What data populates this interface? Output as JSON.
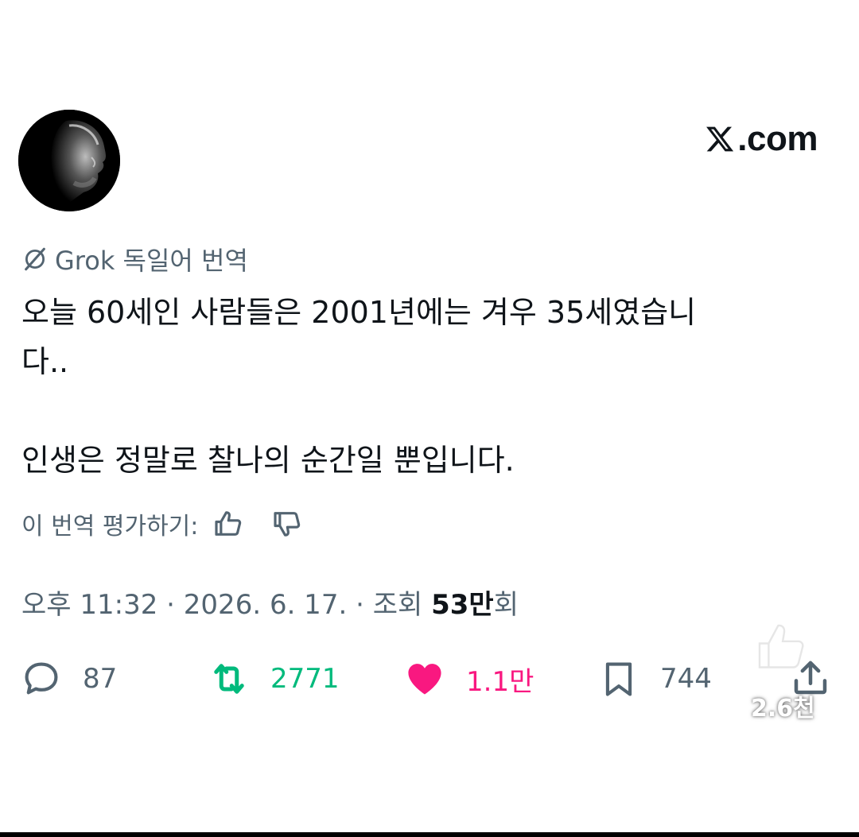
{
  "brand": {
    "icon": "x-logo-icon",
    "text": ".com"
  },
  "translation": {
    "icon": "grok-icon",
    "label": "Grok 독일어 번역"
  },
  "tweet": {
    "line1": "오늘 60세인 사람들은 2001년에는 겨우 35세였습니",
    "line2": "다..",
    "line3": "인생은 정말로 찰나의 순간일 뿐입니다."
  },
  "rate": {
    "label": "이 번역 평가하기:",
    "up_icon": "thumbs-up-icon",
    "down_icon": "thumbs-down-icon"
  },
  "meta": {
    "time": "오후 11:32",
    "sep": "·",
    "date": "2026. 6. 17.",
    "views_label": "조회",
    "views_number": "53만",
    "views_suffix": "회"
  },
  "actions": {
    "replies": "87",
    "reposts": "2771",
    "likes": "1.1만",
    "bookmarks": "744"
  },
  "overlay": {
    "like_count": "2.6천"
  },
  "colors": {
    "text_primary": "#0f1419",
    "text_secondary": "#536471",
    "repost": "#00ba7c",
    "like": "#f91880"
  }
}
